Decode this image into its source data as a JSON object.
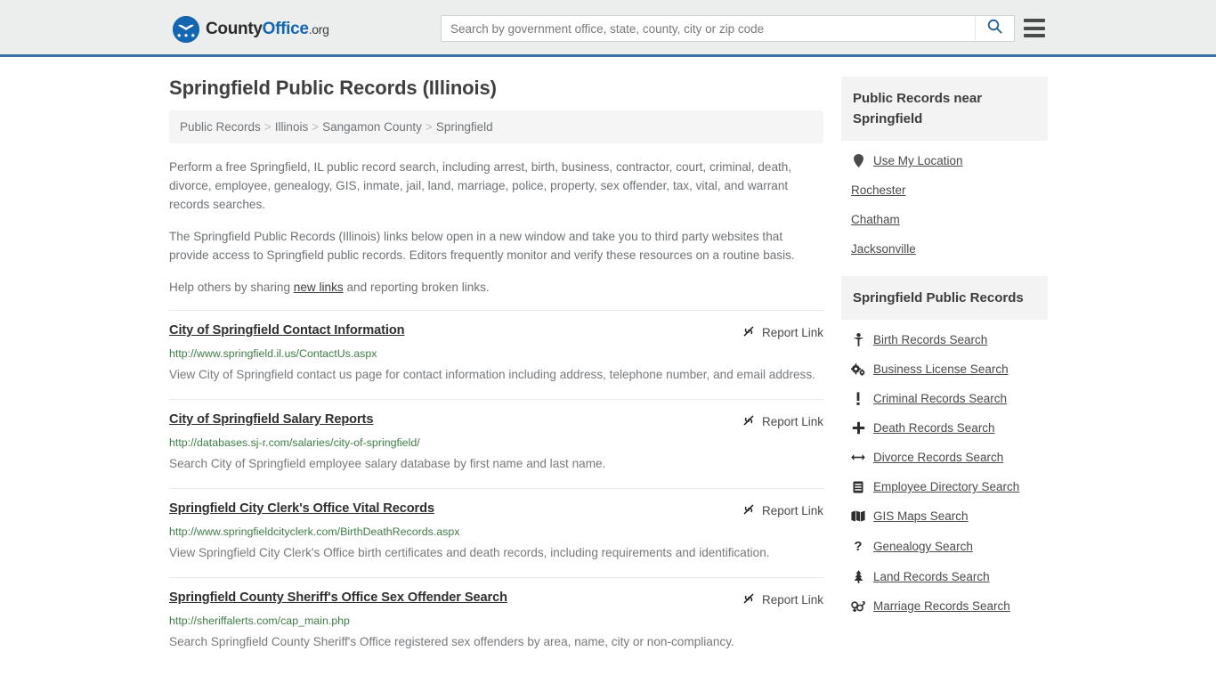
{
  "header": {
    "logo": {
      "part1": "County",
      "part2": "Office",
      "tld": ".org",
      "icon": "eagle-shield-icon"
    },
    "search": {
      "placeholder": "Search by government office, state, county, city or zip code",
      "value": "",
      "button_icon": "search-icon"
    },
    "menu_icon": "hamburger-menu-icon",
    "accent_color": "#3b72a4",
    "background": "#eceded"
  },
  "main": {
    "title": "Springfield Public Records (Illinois)",
    "breadcrumb": [
      "Public Records",
      "Illinois",
      "Sangamon County",
      "Springfield"
    ],
    "breadcrumb_separator": ">",
    "intro_paragraphs": [
      "Perform a free Springfield, IL public record search, including arrest, birth, business, contractor, court, criminal, death, divorce, employee, genealogy, GIS, inmate, jail, land, marriage, police, property, sex offender, tax, vital, and warrant records searches.",
      "The Springfield Public Records (Illinois) links below open in a new window and take you to third party websites that provide access to Springfield public records. Editors frequently monitor and verify these resources on a routine basis."
    ],
    "help_line": {
      "before": "Help others by sharing ",
      "link": "new links",
      "after": " and reporting broken links."
    },
    "report_link_label": "Report Link",
    "report_link_icon": "broken-link-icon",
    "results": [
      {
        "title": "City of Springfield Contact Information",
        "url": "http://www.springfield.il.us/ContactUs.aspx",
        "description": "View City of Springfield contact us page for contact information including address, telephone number, and email address."
      },
      {
        "title": "City of Springfield Salary Reports",
        "url": "http://databases.sj-r.com/salaries/city-of-springfield/",
        "description": "Search City of Springfield employee salary database by first name and last name."
      },
      {
        "title": "Springfield City Clerk's Office Vital Records",
        "url": "http://www.springfieldcityclerk.com/BirthDeathRecords.aspx",
        "description": "View Springfield City Clerk's Office birth certificates and death records, including requirements and identification."
      },
      {
        "title": "Springfield County Sheriff's Office Sex Offender Search",
        "url": "http://sheriffalerts.com/cap_main.php",
        "description": "Search Springfield County Sheriff's Office registered sex offenders by area, name, city or non-compliancy."
      }
    ]
  },
  "sidebar": {
    "cards": [
      {
        "title": "Public Records near Springfield",
        "items": [
          {
            "label": "Use My Location",
            "icon": "map-pin-icon"
          },
          {
            "label": "Rochester",
            "icon": ""
          },
          {
            "label": "Chatham",
            "icon": ""
          },
          {
            "label": "Jacksonville",
            "icon": ""
          }
        ]
      },
      {
        "title": "Springfield Public Records",
        "items": [
          {
            "label": "Birth Records Search",
            "icon": "baby-icon"
          },
          {
            "label": "Business License Search",
            "icon": "gears-icon"
          },
          {
            "label": "Criminal Records Search",
            "icon": "exclamation-icon"
          },
          {
            "label": "Death Records Search",
            "icon": "cross-icon"
          },
          {
            "label": "Divorce Records Search",
            "icon": "arrows-split-icon"
          },
          {
            "label": "Employee Directory Search",
            "icon": "id-card-icon"
          },
          {
            "label": "GIS Maps Search",
            "icon": "map-icon"
          },
          {
            "label": "Genealogy Search",
            "icon": "question-mark-icon"
          },
          {
            "label": "Land Records Search",
            "icon": "tree-icon"
          },
          {
            "label": "Marriage Records Search",
            "icon": "venus-mars-icon"
          }
        ]
      }
    ]
  }
}
